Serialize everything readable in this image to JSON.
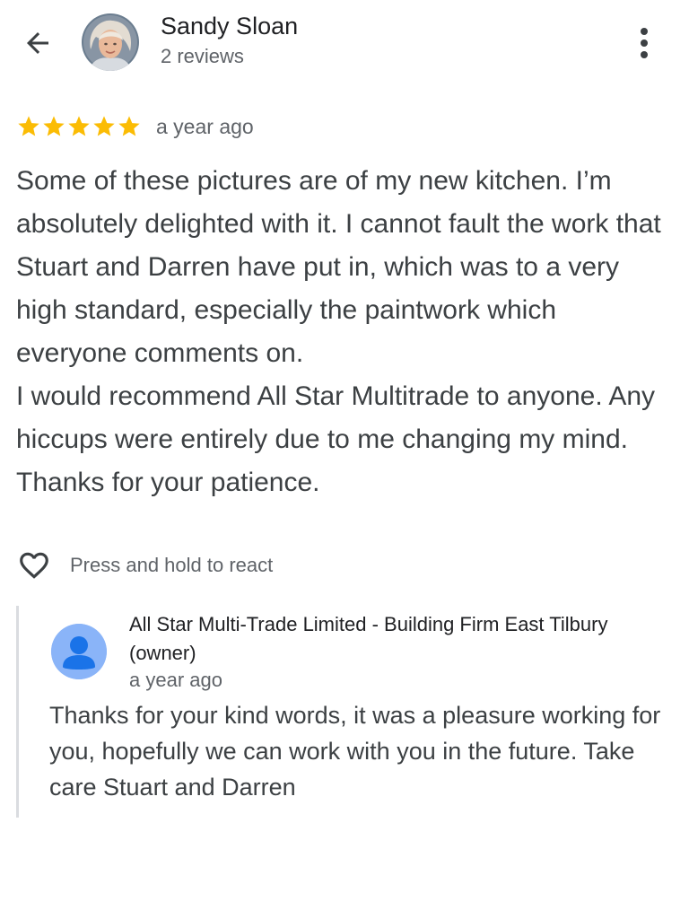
{
  "header": {
    "reviewer_name": "Sandy Sloan",
    "reviewer_reviews": "2 reviews",
    "icons": {
      "back": "arrow-back-icon",
      "more": "more-vert-icon",
      "avatar": "profile-photo"
    }
  },
  "review": {
    "rating": 5,
    "rating_max": 5,
    "star_color": "#fbbc04",
    "time": "a year ago",
    "paragraphs": [
      "Some of these pictures are of my new kitchen. I’m absolutely delighted with it. I cannot fault the work that Stuart and Darren have put in, which was to a very high standard, especially the paintwork which everyone comments on.",
      "I would recommend All Star Multitrade to anyone. Any hiccups were entirely due to me changing my mind. Thanks for your patience."
    ]
  },
  "reaction": {
    "icon": "heart-outline-icon",
    "label": "Press and hold to react"
  },
  "owner_reply": {
    "name": "All Star Multi-Trade Limited - Building Firm East Tilbury (owner)",
    "time": "a year ago",
    "text": "Thanks for your kind words, it was a pleasure working for you, hopefully we can work with you in the future. Take care Stuart and Darren",
    "avatar_icon": "default-person-icon",
    "avatar_color": "#8ab4f8",
    "avatar_figure_color": "#1a73e8"
  }
}
